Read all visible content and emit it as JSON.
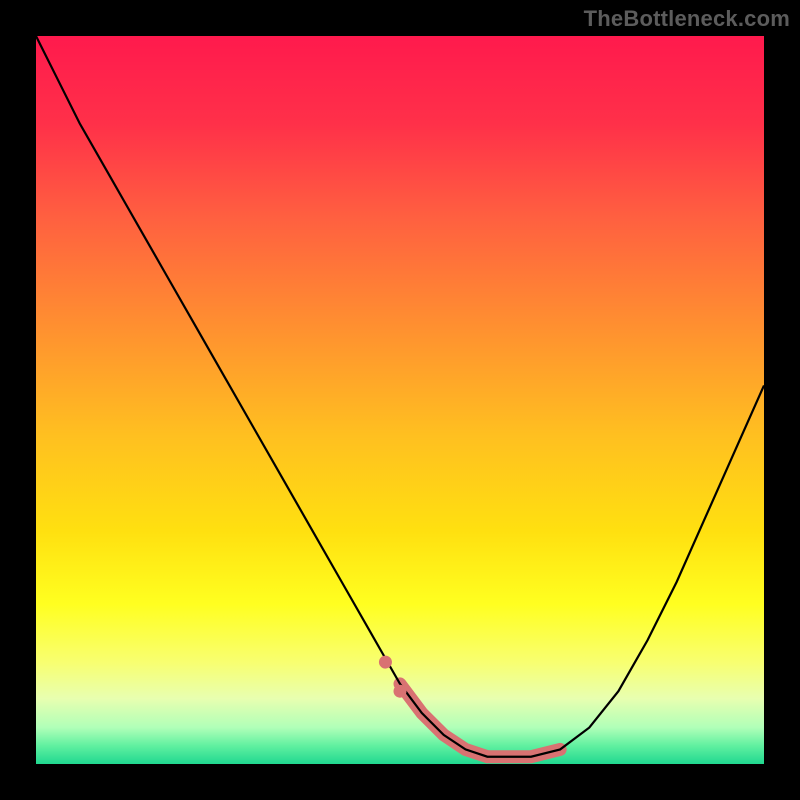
{
  "watermark": "TheBottleneck.com",
  "gradient_stops": [
    {
      "offset": 0.0,
      "color": "#ff1a4d"
    },
    {
      "offset": 0.12,
      "color": "#ff3049"
    },
    {
      "offset": 0.25,
      "color": "#ff6040"
    },
    {
      "offset": 0.4,
      "color": "#ff9030"
    },
    {
      "offset": 0.55,
      "color": "#ffc020"
    },
    {
      "offset": 0.68,
      "color": "#ffe010"
    },
    {
      "offset": 0.78,
      "color": "#ffff20"
    },
    {
      "offset": 0.86,
      "color": "#f8ff70"
    },
    {
      "offset": 0.91,
      "color": "#e8ffb0"
    },
    {
      "offset": 0.95,
      "color": "#b0ffb8"
    },
    {
      "offset": 0.975,
      "color": "#60f0a0"
    },
    {
      "offset": 1.0,
      "color": "#20d890"
    }
  ],
  "chart_data": {
    "type": "line",
    "title": "",
    "xlabel": "",
    "ylabel": "",
    "xlim": [
      0,
      100
    ],
    "ylim": [
      0,
      100
    ],
    "series": [
      {
        "name": "bottleneck-curve",
        "color": "#000000",
        "width": 2.2,
        "x": [
          0,
          3,
          6,
          10,
          14,
          18,
          22,
          26,
          30,
          34,
          38,
          42,
          46,
          50,
          53,
          56,
          59,
          62,
          65,
          68,
          72,
          76,
          80,
          84,
          88,
          92,
          96,
          100
        ],
        "y": [
          100,
          94,
          88,
          81,
          74,
          67,
          60,
          53,
          46,
          39,
          32,
          25,
          18,
          11,
          7,
          4,
          2,
          1,
          1,
          1,
          2,
          5,
          10,
          17,
          25,
          34,
          43,
          52
        ]
      },
      {
        "name": "highlight-band",
        "color": "#d97272",
        "width": 13,
        "linecap": "round",
        "x": [
          50,
          53,
          56,
          59,
          62,
          65,
          68,
          72
        ],
        "y": [
          11,
          7,
          4,
          2,
          1,
          1,
          1,
          2
        ]
      }
    ],
    "markers": [
      {
        "name": "dot-1",
        "x": 48,
        "y": 14,
        "r": 6.5,
        "color": "#d97272"
      },
      {
        "name": "dot-2",
        "x": 50,
        "y": 10,
        "r": 6.5,
        "color": "#d97272"
      }
    ]
  }
}
